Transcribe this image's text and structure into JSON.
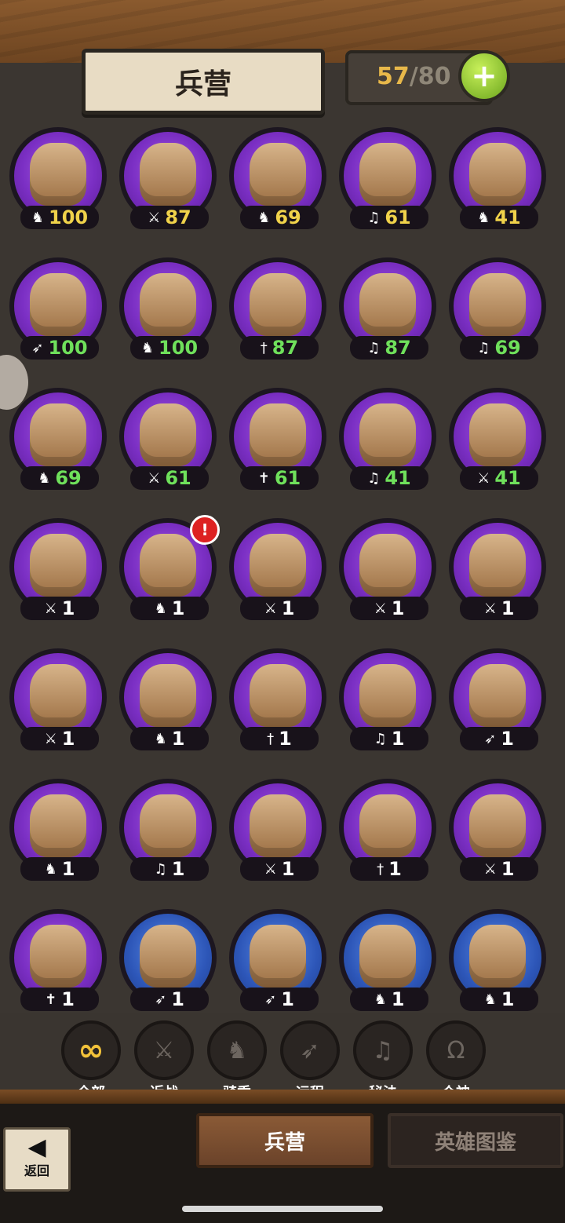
{
  "header": {
    "title": "兵营",
    "capacity_current": "57",
    "capacity_total": "/80",
    "add_label": "+"
  },
  "units": [
    {
      "icon": "♞",
      "value": "100",
      "tone": "yellow"
    },
    {
      "icon": "⚔",
      "value": "87",
      "tone": "yellow"
    },
    {
      "icon": "♞",
      "value": "69",
      "tone": "yellow"
    },
    {
      "icon": "♫",
      "value": "61",
      "tone": "yellow"
    },
    {
      "icon": "♞",
      "value": "41",
      "tone": "yellow"
    },
    {
      "icon": "➶",
      "value": "100",
      "tone": "green"
    },
    {
      "icon": "♞",
      "value": "100",
      "tone": "green"
    },
    {
      "icon": "†",
      "value": "87",
      "tone": "green"
    },
    {
      "icon": "♫",
      "value": "87",
      "tone": "green"
    },
    {
      "icon": "♫",
      "value": "69",
      "tone": "green"
    },
    {
      "icon": "♞",
      "value": "69",
      "tone": "green"
    },
    {
      "icon": "⚔",
      "value": "61",
      "tone": "green"
    },
    {
      "icon": "✝",
      "value": "61",
      "tone": "green"
    },
    {
      "icon": "♫",
      "value": "41",
      "tone": "green"
    },
    {
      "icon": "⚔",
      "value": "41",
      "tone": "green"
    },
    {
      "icon": "⚔",
      "value": "1",
      "tone": "white"
    },
    {
      "icon": "♞",
      "value": "1",
      "tone": "white",
      "alert": "!"
    },
    {
      "icon": "⚔",
      "value": "1",
      "tone": "white"
    },
    {
      "icon": "⚔",
      "value": "1",
      "tone": "white"
    },
    {
      "icon": "⚔",
      "value": "1",
      "tone": "white"
    },
    {
      "icon": "⚔",
      "value": "1",
      "tone": "white"
    },
    {
      "icon": "♞",
      "value": "1",
      "tone": "white"
    },
    {
      "icon": "†",
      "value": "1",
      "tone": "white"
    },
    {
      "icon": "♫",
      "value": "1",
      "tone": "white"
    },
    {
      "icon": "➶",
      "value": "1",
      "tone": "white"
    },
    {
      "icon": "♞",
      "value": "1",
      "tone": "white"
    },
    {
      "icon": "♫",
      "value": "1",
      "tone": "white"
    },
    {
      "icon": "⚔",
      "value": "1",
      "tone": "white"
    },
    {
      "icon": "†",
      "value": "1",
      "tone": "white"
    },
    {
      "icon": "⚔",
      "value": "1",
      "tone": "white"
    },
    {
      "icon": "✝",
      "value": "1",
      "tone": "white"
    },
    {
      "icon": "➶",
      "value": "1",
      "tone": "white",
      "blue": true
    },
    {
      "icon": "➶",
      "value": "1",
      "tone": "white",
      "blue": true
    },
    {
      "icon": "♞",
      "value": "1",
      "tone": "white",
      "blue": true
    },
    {
      "icon": "♞",
      "value": "1",
      "tone": "white",
      "blue": true
    }
  ],
  "filters": [
    {
      "label": "全部",
      "glyph": "∞",
      "active": true
    },
    {
      "label": "近战",
      "glyph": "⚔"
    },
    {
      "label": "骑乘",
      "glyph": "♞"
    },
    {
      "label": "远程",
      "glyph": "➶"
    },
    {
      "label": "秘法",
      "glyph": "♫"
    },
    {
      "label": "众神",
      "glyph": "Ω"
    }
  ],
  "tabs": {
    "barracks": "兵营",
    "hero_codex": "英雄图鉴"
  },
  "back": {
    "arrow": "◀",
    "label": "返回"
  },
  "colors": {
    "accent_gold": "#e8b84a",
    "level_green": "#6fe05b",
    "frame_purple": "#7b2fc4",
    "frame_blue": "#2d56b8"
  }
}
